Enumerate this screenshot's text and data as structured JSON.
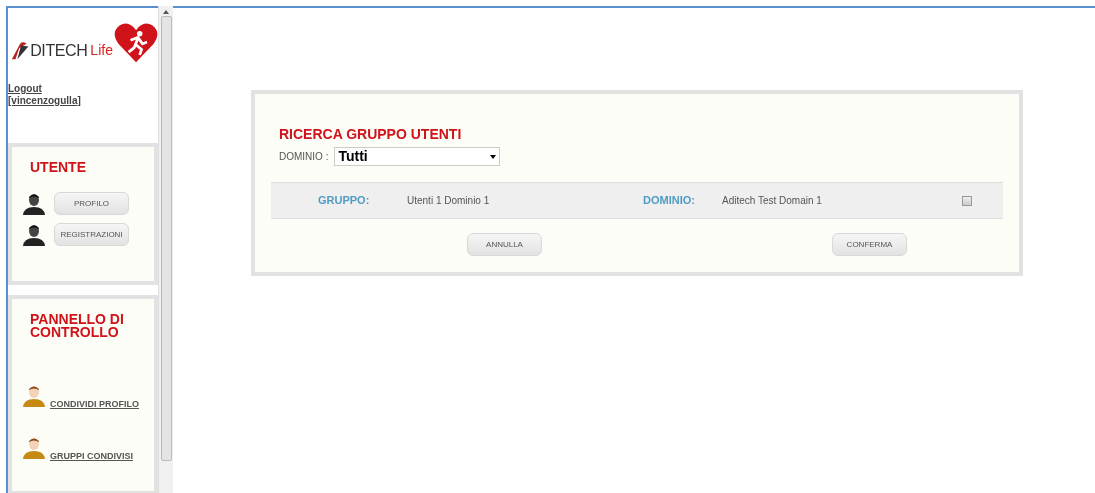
{
  "logo": {
    "text": "DITECH",
    "suffix": "Life"
  },
  "user": {
    "logout": "Logout",
    "username": "[vincenzogulla]"
  },
  "panels": [
    {
      "title": "UTENTE",
      "items": [
        {
          "kind": "button",
          "label": "PROFILO"
        },
        {
          "kind": "button",
          "label": "REGISTRAZIONI"
        }
      ]
    },
    {
      "title": "PANNELLO DI CONTROLLO",
      "items": [
        {
          "kind": "link",
          "label": "CONDIVIDI PROFILO"
        },
        {
          "kind": "link",
          "label": "GRUPPI CONDIVISI"
        }
      ]
    }
  ],
  "search": {
    "title": "RICERCA GRUPPO UTENTI",
    "filter_label": "DOMINIO :",
    "filter_value": "Tutti",
    "rows": [
      {
        "group_label": "GRUPPO:",
        "group": "Utenti 1 Dominio 1",
        "domain_label": "DOMINIO:",
        "domain": "Aditech Test Domain 1",
        "checked": false
      }
    ],
    "buttons": [
      "ANNULLA",
      "CONFERMA"
    ]
  }
}
